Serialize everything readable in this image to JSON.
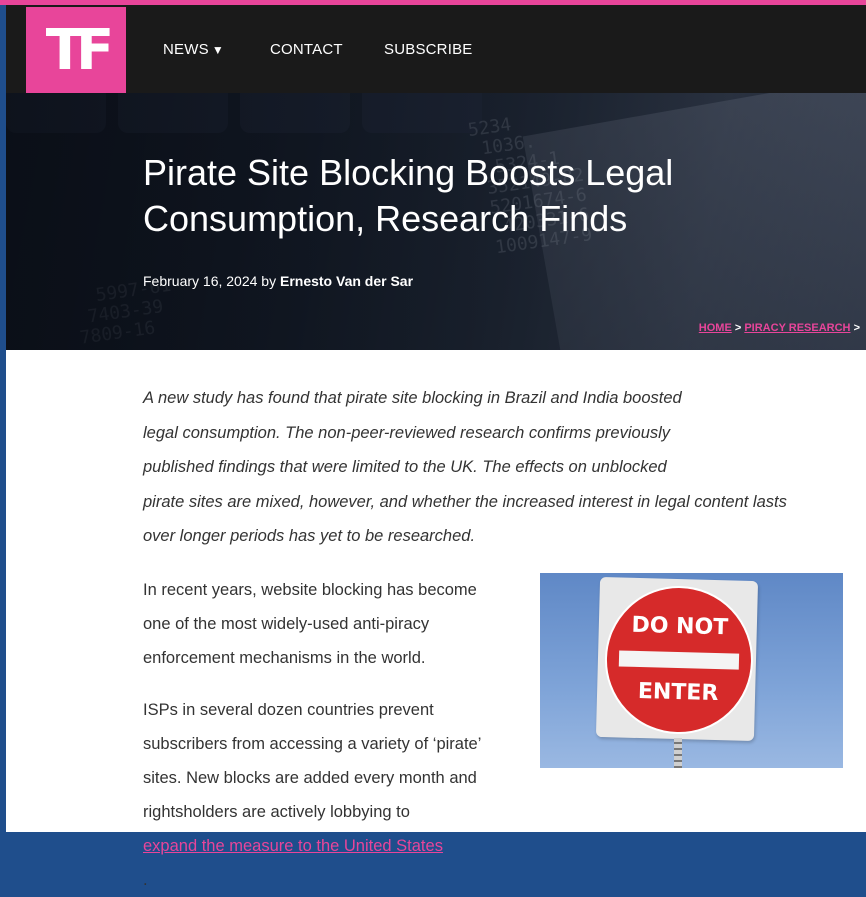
{
  "nav": {
    "logo": "TF",
    "items": [
      {
        "label": "NEWS",
        "has_caret": true
      },
      {
        "label": "CONTACT",
        "has_caret": false
      },
      {
        "label": "SUBSCRIBE",
        "has_caret": false
      }
    ],
    "caret": "▼"
  },
  "hero": {
    "title_line1": "Pirate Site Blocking Boosts Legal",
    "title_line2": "Consumption, Research Finds",
    "date": "February 16, 2024",
    "by": "by",
    "author": "Ernesto Van der Sar",
    "breadcrumb": {
      "home": "HOME",
      "sep": ">",
      "category": "PIRACY RESEARCH",
      "trail": ">"
    }
  },
  "article": {
    "lead_lines": [
      "A new study has found that pirate site blocking in Brazil and India boosted",
      "legal consumption. The non-peer-reviewed research confirms previously",
      "published findings that were limited to the UK. The effects on unblocked",
      "pirate sites are mixed, however, and whether the increased interest in legal content lasts",
      "over longer periods has yet to be researched."
    ],
    "para1_lines": [
      "In recent years, website blocking has become",
      "one of the most widely-used anti-piracy",
      "enforcement mechanisms in the world."
    ],
    "para2_lines": [
      "ISPs in several dozen countries prevent",
      "subscribers from accessing a variety of ‘pirate’",
      "sites. New blocks are added every month and"
    ],
    "para2_last_prefix": "rightsholders are actively lobbying to ",
    "para2_link": "expand the measure to the United States",
    "para2_last_suffix": "."
  },
  "image": {
    "sign_top": "DO NOT",
    "sign_bottom": "ENTER"
  },
  "colors": {
    "accent": "#e8459a",
    "nav_bg": "#1a1a1a",
    "frame": "#1f4e8c"
  }
}
